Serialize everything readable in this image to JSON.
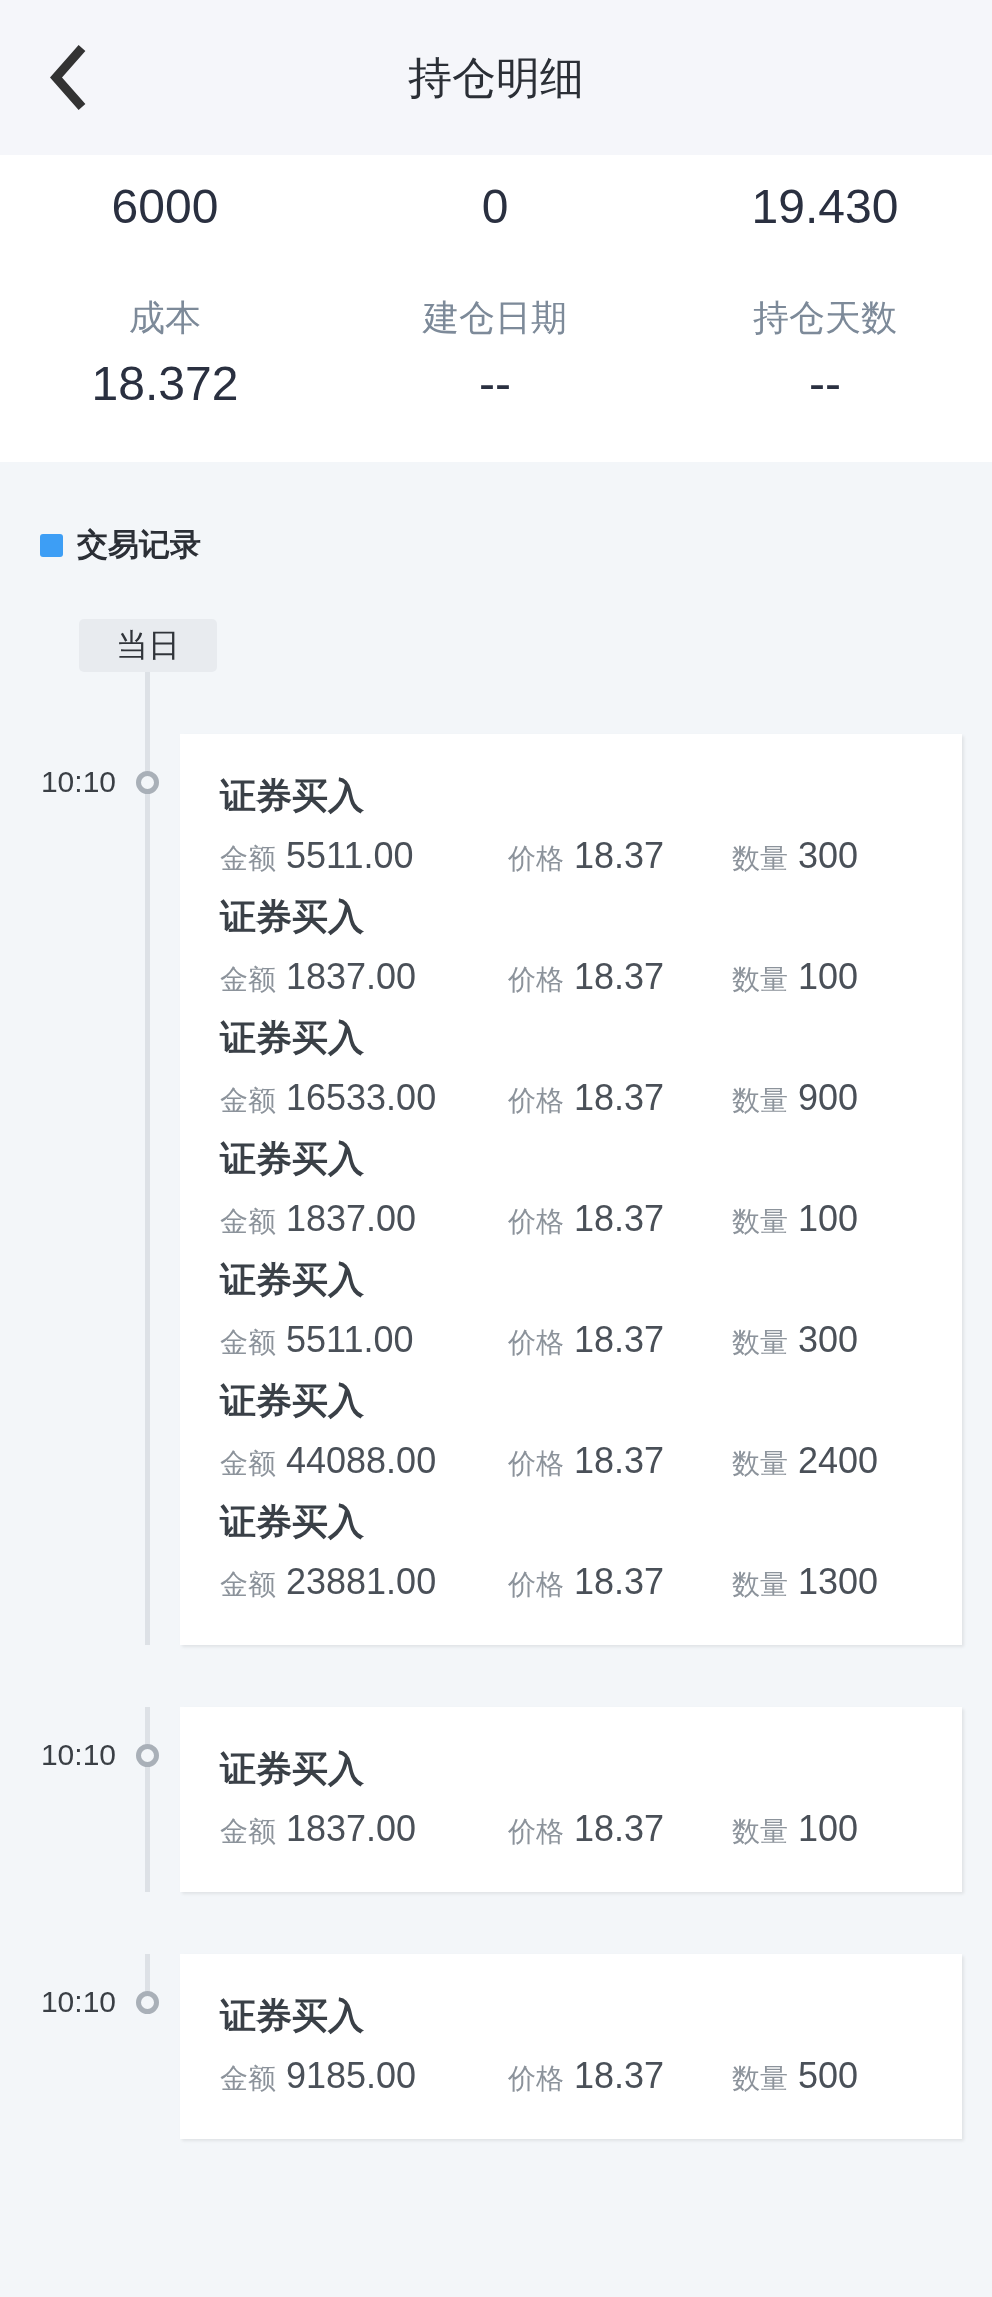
{
  "header": {
    "title": "持仓明细"
  },
  "stats": [
    {
      "value": "6000"
    },
    {
      "value": "0"
    },
    {
      "value": "19.430"
    },
    {
      "label": "成本",
      "value": "18.372"
    },
    {
      "label": "建仓日期",
      "value": "--"
    },
    {
      "label": "持仓天数",
      "value": "--"
    }
  ],
  "records": {
    "title": "交易记录",
    "date_chip": "当日",
    "entries": [
      {
        "time": "10:10",
        "trades": [
          {
            "type": "证券买入",
            "fields": [
              {
                "label": "金额",
                "value": "5511.00"
              },
              {
                "label": "价格",
                "value": "18.37"
              },
              {
                "label": "数量",
                "value": "300"
              }
            ]
          },
          {
            "type": "证券买入",
            "fields": [
              {
                "label": "金额",
                "value": "1837.00"
              },
              {
                "label": "价格",
                "value": "18.37"
              },
              {
                "label": "数量",
                "value": "100"
              }
            ]
          },
          {
            "type": "证券买入",
            "fields": [
              {
                "label": "金额",
                "value": "16533.00"
              },
              {
                "label": "价格",
                "value": "18.37"
              },
              {
                "label": "数量",
                "value": "900"
              }
            ]
          },
          {
            "type": "证券买入",
            "fields": [
              {
                "label": "金额",
                "value": "1837.00"
              },
              {
                "label": "价格",
                "value": "18.37"
              },
              {
                "label": "数量",
                "value": "100"
              }
            ]
          },
          {
            "type": "证券买入",
            "fields": [
              {
                "label": "金额",
                "value": "5511.00"
              },
              {
                "label": "价格",
                "value": "18.37"
              },
              {
                "label": "数量",
                "value": "300"
              }
            ]
          },
          {
            "type": "证券买入",
            "fields": [
              {
                "label": "金额",
                "value": "44088.00"
              },
              {
                "label": "价格",
                "value": "18.37"
              },
              {
                "label": "数量",
                "value": "2400"
              }
            ]
          },
          {
            "type": "证券买入",
            "fields": [
              {
                "label": "金额",
                "value": "23881.00"
              },
              {
                "label": "价格",
                "value": "18.37"
              },
              {
                "label": "数量",
                "value": "1300"
              }
            ]
          }
        ]
      },
      {
        "time": "10:10",
        "trades": [
          {
            "type": "证券买入",
            "fields": [
              {
                "label": "金额",
                "value": "1837.00"
              },
              {
                "label": "价格",
                "value": "18.37"
              },
              {
                "label": "数量",
                "value": "100"
              }
            ]
          }
        ]
      },
      {
        "time": "10:10",
        "trades": [
          {
            "type": "证券买入",
            "fields": [
              {
                "label": "金额",
                "value": "9185.00"
              },
              {
                "label": "价格",
                "value": "18.37"
              },
              {
                "label": "数量",
                "value": "500"
              }
            ]
          }
        ]
      }
    ]
  }
}
